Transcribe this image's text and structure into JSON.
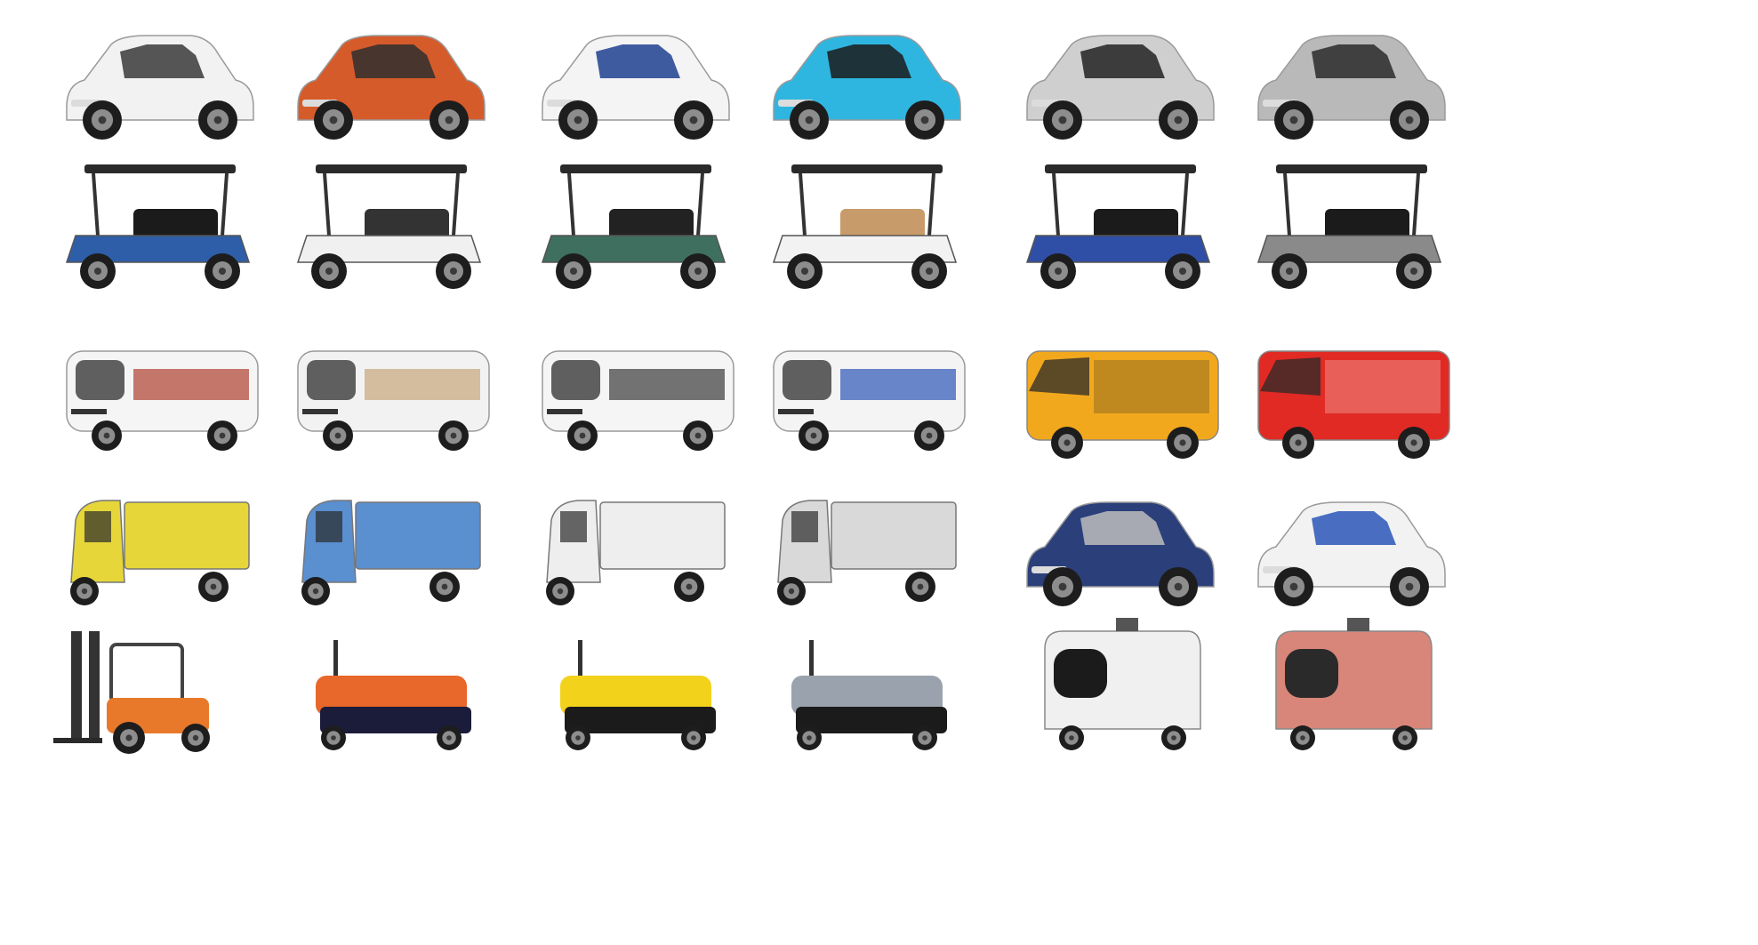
{
  "rows": [
    [
      {
        "name": "white-mini-city-car",
        "icon": "white-compact-ev-icon",
        "body": "#f2f2f2",
        "accent": "#3a3a3a"
      },
      {
        "name": "orange-mini-suv",
        "icon": "orange-mini-car-icon",
        "body": "#d65b2a",
        "accent": "#2f2f2f"
      },
      {
        "name": "white-blue-stripe-microcar",
        "icon": "white-microcar-icon",
        "body": "#f4f4f4",
        "accent": "#1e3f8f"
      },
      {
        "name": "blue-bubble-ev",
        "icon": "blue-bubble-car-icon",
        "body": "#2fb6e0",
        "accent": "#1b1b1b"
      },
      {
        "name": "grey-quadricycle",
        "icon": "grey-quadricycle-icon",
        "body": "#cfcfcf",
        "accent": "#222222"
      },
      {
        "name": "silver-two-seat-ev",
        "icon": "silver-two-seater-icon",
        "body": "#b9b9b9",
        "accent": "#2a2a2a"
      }
    ],
    [
      {
        "name": "blue-lifted-golf-cart",
        "icon": "lifted-golf-cart-icon",
        "body": "#2e5ea8",
        "accent": "#1b1b1b"
      },
      {
        "name": "white-utility-cart",
        "icon": "white-utility-cart-icon",
        "body": "#f0f0f0",
        "accent": "#333333"
      },
      {
        "name": "green-golf-cart",
        "icon": "green-golf-cart-icon",
        "body": "#3f6f5e",
        "accent": "#222222"
      },
      {
        "name": "white-tan-seat-shuttle-cart",
        "icon": "shuttle-cart-icon",
        "body": "#f2f2f2",
        "accent": "#c89b6a"
      },
      {
        "name": "blue-six-seat-cart",
        "icon": "six-seat-cart-icon",
        "body": "#2f4ea5",
        "accent": "#1b1b1b"
      },
      {
        "name": "grey-six-seat-cart",
        "icon": "grey-six-seat-cart-icon",
        "body": "#8a8a8a",
        "accent": "#1b1b1b"
      }
    ],
    [
      {
        "name": "white-sightseeing-car",
        "icon": "sightseeing-car-icon",
        "body": "#f5f5f5",
        "accent": "#b04030"
      },
      {
        "name": "white-beige-sightseeing-bus",
        "icon": "sightseeing-bus-icon",
        "body": "#f2f2f2",
        "accent": "#c8a67a"
      },
      {
        "name": "white-shuttle-bus",
        "icon": "shuttle-bus-icon",
        "body": "#f5f5f5",
        "accent": "#3a3a3a"
      },
      {
        "name": "white-blue-seat-shuttle",
        "icon": "blue-seat-shuttle-icon",
        "body": "#f4f4f4",
        "accent": "#2c56b8"
      },
      {
        "name": "yellow-cargo-van",
        "icon": "yellow-van-icon",
        "body": "#f2a81d",
        "accent": "#2a2a2a"
      },
      {
        "name": "red-fire-truck",
        "icon": "fire-truck-icon",
        "body": "#e02a23",
        "accent": "#ffffff"
      }
    ],
    [
      {
        "name": "yellow-cargo-tricycle",
        "icon": "yellow-tricycle-icon",
        "body": "#e6d63a",
        "accent": "#2a2a2a"
      },
      {
        "name": "blue-flatbed-tricycle",
        "icon": "blue-flatbed-tricycle-icon",
        "body": "#5a8fd0",
        "accent": "#2a2a2a"
      },
      {
        "name": "white-box-tricycle",
        "icon": "box-tricycle-icon",
        "body": "#eeeeee",
        "accent": "#2a2a2a"
      },
      {
        "name": "grey-box-tricycle",
        "icon": "grey-box-tricycle-icon",
        "body": "#d9d9d9",
        "accent": "#2a2a2a"
      },
      {
        "name": "blue-utility-cart",
        "icon": "utility-cart-icon",
        "body": "#2b3f7a",
        "accent": "#bdbdbd"
      },
      {
        "name": "white-patrol-car",
        "icon": "patrol-car-icon",
        "body": "#f2f2f2",
        "accent": "#2c56b8"
      }
    ],
    [
      {
        "name": "orange-forklift",
        "icon": "forklift-icon",
        "body": "#e8792a",
        "accent": "#333333"
      },
      {
        "name": "orange-tow-tractor",
        "icon": "tow-tractor-icon",
        "body": "#e8672a",
        "accent": "#1b1b3a"
      },
      {
        "name": "yellow-electric-tug",
        "icon": "electric-tug-icon",
        "body": "#f3d21c",
        "accent": "#1b1b1b"
      },
      {
        "name": "grey-baggage-tractor",
        "icon": "baggage-tractor-icon",
        "body": "#9aa3ad",
        "accent": "#1b1b1b"
      },
      {
        "name": "white-delivery-robot",
        "icon": "delivery-robot-icon",
        "body": "#f0f0f0",
        "accent": "#1b1b1b"
      },
      {
        "name": "pink-delivery-robot",
        "icon": "pink-robot-icon",
        "body": "#d9867a",
        "accent": "#2a2a2a"
      }
    ]
  ]
}
